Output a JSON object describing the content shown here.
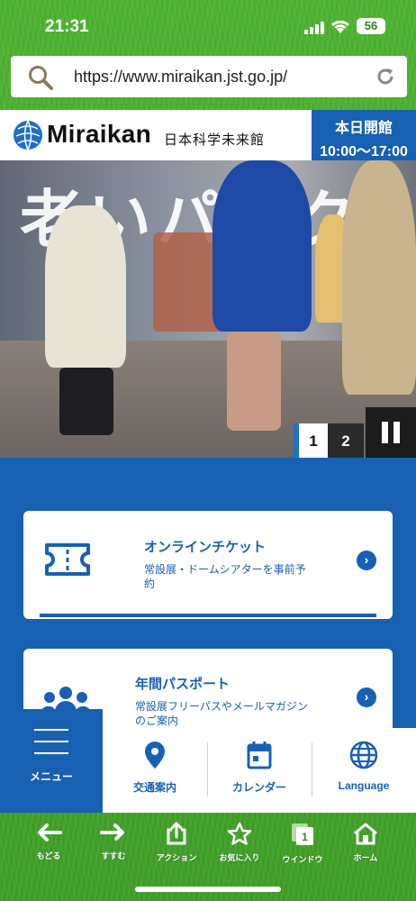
{
  "status_bar": {
    "time": "21:31",
    "battery": "56"
  },
  "browser": {
    "url": "https://www.miraikan.jst.go.jp/"
  },
  "site_header": {
    "logo_text": "Miraikan",
    "logo_subtitle": "日本科学未来館",
    "hours_label": "本日開館",
    "hours_value": "10:00〜17:00"
  },
  "hero": {
    "overlay_text": "老いパーク",
    "pager": [
      "1",
      "2"
    ],
    "current_slide": "1"
  },
  "cards": [
    {
      "title": "オンラインチケット",
      "description": "常設展・ドームシアターを事前予約"
    },
    {
      "title": "年間パスポート",
      "description": "常設展フリーパスやメールマガジンのご案内"
    }
  ],
  "site_nav": {
    "menu_label": "メニュー",
    "items": [
      {
        "label": "交通案内",
        "icon": "location-pin-icon"
      },
      {
        "label": "カレンダー",
        "icon": "calendar-icon"
      },
      {
        "label": "Language",
        "icon": "globe-icon"
      }
    ]
  },
  "toolbar": {
    "items": [
      {
        "label": "もどる",
        "icon": "back-arrow-icon"
      },
      {
        "label": "すすむ",
        "icon": "forward-arrow-icon"
      },
      {
        "label": "アクション",
        "icon": "share-icon"
      },
      {
        "label": "お気に入り",
        "icon": "star-icon"
      },
      {
        "label": "ウインドウ",
        "icon": "windows-icon",
        "badge": "1"
      },
      {
        "label": "ホーム",
        "icon": "home-icon"
      }
    ]
  },
  "colors": {
    "brand_blue": "#1760b2",
    "grass_green": "#3f9f27"
  }
}
